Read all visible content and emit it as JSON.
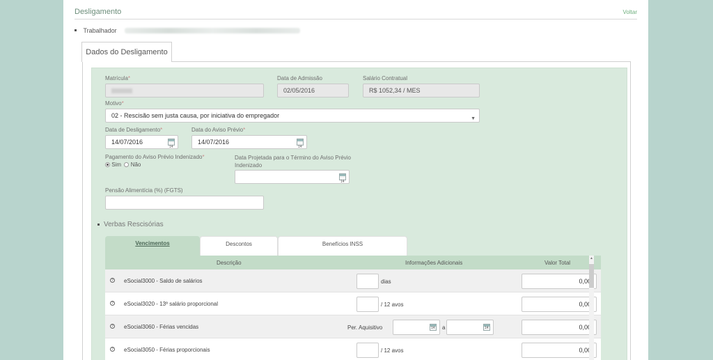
{
  "header": {
    "title": "Desligamento",
    "back_label": "Voltar"
  },
  "worker": {
    "label": "Trabalhador"
  },
  "main_tab": {
    "label": "Dados do Desligamento"
  },
  "form": {
    "matricula": {
      "label": "Matrícula",
      "required": "*"
    },
    "data_admissao": {
      "label": "Data de Admissão",
      "value": "02/05/2016"
    },
    "salario": {
      "label": "Salário Contratual",
      "value": "R$ 1052,34 / MES"
    },
    "motivo": {
      "label": "Motivo",
      "required": "*",
      "value": "02 - Rescisão sem justa causa, por iniciativa do empregador"
    },
    "data_desligamento": {
      "label": "Data de Desligamento",
      "required": "*",
      "value": "14/07/2016"
    },
    "data_aviso": {
      "label": "Data do Aviso Prévio",
      "required": "*",
      "value": "14/07/2016"
    },
    "pagamento_aviso": {
      "label": "Pagamento do Aviso Prévio Indenizado",
      "required": "*",
      "option_sim": "Sim",
      "option_nao": "Não",
      "selected": "Sim"
    },
    "data_projetada": {
      "label_line1": "Data Projetada para o Término do Aviso Prévio",
      "label_line2": "Indenizado",
      "value": ""
    },
    "pensao": {
      "label": "Pensão Alimentícia (%) (FGTS)",
      "value": ""
    }
  },
  "verbas": {
    "section_title": "Verbas Rescisórias",
    "tabs": [
      {
        "label": "Vencimentos",
        "active": true
      },
      {
        "label": "Descontos",
        "active": false
      },
      {
        "label": "Benefícios INSS",
        "active": false
      }
    ],
    "columns": [
      "Descrição",
      "Informações Adicionais",
      "Valor Total"
    ],
    "rows": [
      {
        "desc": "eSocial3000 - Saldo de salários",
        "unit": "dias",
        "value": "0,00"
      },
      {
        "desc": "eSocial3020 - 13º salário proporcional",
        "unit": "/ 12 avos",
        "value": "0,00"
      },
      {
        "desc": "eSocial3060 - Férias vencidas",
        "period_label": "Per. Aquisitivo",
        "period_sep": "a",
        "value": "0,00"
      },
      {
        "desc": "eSocial3050 - Férias proporcionais",
        "unit": "/ 12 avos",
        "value": "0,00"
      }
    ]
  },
  "colors": {
    "background": "#b8d4cd",
    "form_bg": "#d9eadd",
    "accent": "#c3dcc8"
  }
}
